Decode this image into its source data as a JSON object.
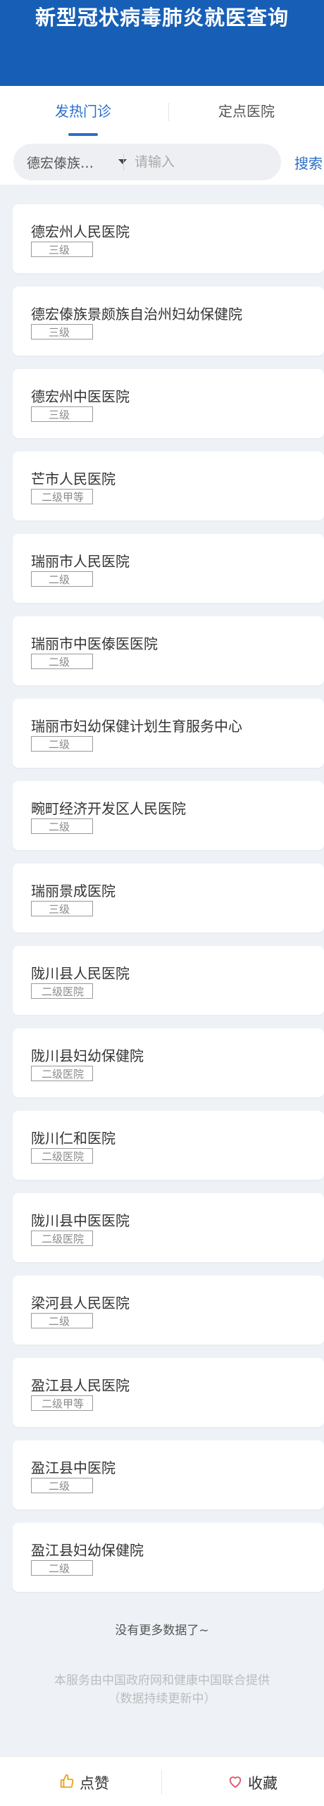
{
  "header": {
    "title": "新型冠状病毒肺炎就医查询",
    "bg_color": "#175fb6"
  },
  "tabs": [
    {
      "label": "发热门诊",
      "active": true
    },
    {
      "label": "定点医院",
      "active": false
    }
  ],
  "search": {
    "region_value": "德宏傣族…",
    "placeholder": "请输入",
    "button_label": "搜索"
  },
  "hospitals": [
    {
      "name": "德宏州人民医院",
      "level": "三级"
    },
    {
      "name": "德宏傣族景颇族自治州妇幼保健院",
      "level": "三级"
    },
    {
      "name": "德宏州中医医院",
      "level": "三级"
    },
    {
      "name": "芒市人民医院",
      "level": "二级甲等"
    },
    {
      "name": "瑞丽市人民医院",
      "level": "二级"
    },
    {
      "name": "瑞丽市中医傣医医院",
      "level": "二级"
    },
    {
      "name": "瑞丽市妇幼保健计划生育服务中心",
      "level": "二级"
    },
    {
      "name": "畹町经济开发区人民医院",
      "level": "二级"
    },
    {
      "name": "瑞丽景成医院",
      "level": "三级"
    },
    {
      "name": "陇川县人民医院",
      "level": "二级医院"
    },
    {
      "name": "陇川县妇幼保健院",
      "level": "二级医院"
    },
    {
      "name": "陇川仁和医院",
      "level": "二级医院"
    },
    {
      "name": "陇川县中医医院",
      "level": "二级医院"
    },
    {
      "name": "梁河县人民医院",
      "level": "二级"
    },
    {
      "name": "盈江县人民医院",
      "level": "二级甲等"
    },
    {
      "name": "盈江县中医院",
      "level": "二级"
    },
    {
      "name": "盈江县妇幼保健院",
      "level": "二级"
    }
  ],
  "end_note": "没有更多数据了~",
  "footer": {
    "line1": "本服务由中国政府网和健康中国联合提供",
    "line2": "（数据持续更新中）"
  },
  "bottom_bar": {
    "like_label": "点赞",
    "favorite_label": "收藏",
    "accent_color": "#e8a317",
    "heart_color": "#e0556a"
  }
}
